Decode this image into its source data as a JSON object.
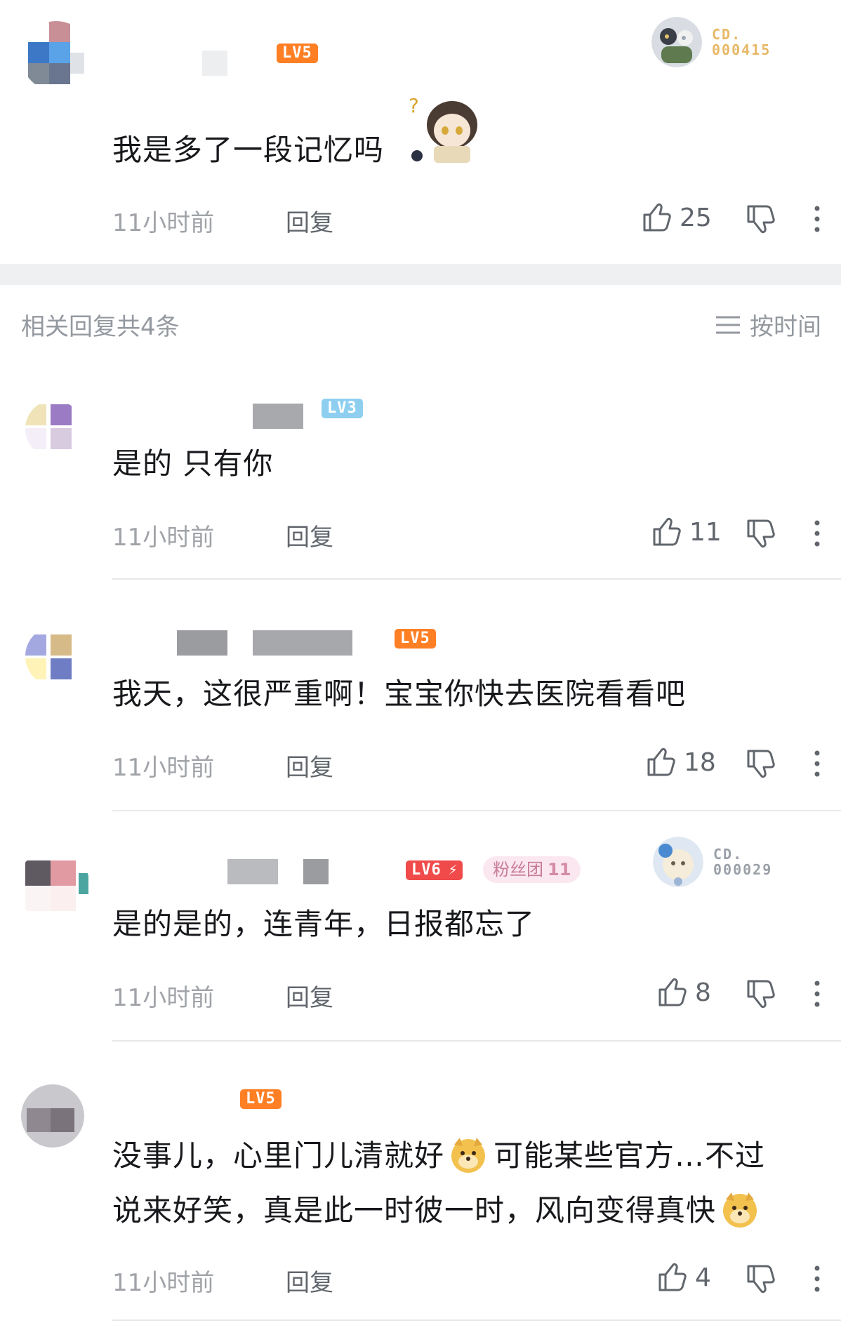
{
  "main_comment": {
    "level": "LV5",
    "text": "我是多了一段记忆吗",
    "time": "11小时前",
    "reply_label": "回复",
    "likes": "25",
    "badge": {
      "line1": "CD.",
      "line2": "000415"
    }
  },
  "related": {
    "header": "相关回复共4条",
    "sort_label": "按时间"
  },
  "replies": [
    {
      "level": "LV3",
      "text": "是的 只有你",
      "time": "11小时前",
      "reply_label": "回复",
      "likes": "11"
    },
    {
      "level": "LV5",
      "text": "我天，这很严重啊！宝宝你快去医院看看吧",
      "time": "11小时前",
      "reply_label": "回复",
      "likes": "18"
    },
    {
      "level": "LV6",
      "fan_label": "粉丝团",
      "fan_level": "11",
      "text": "是的是的，连青年，日报都忘了",
      "time": "11小时前",
      "reply_label": "回复",
      "likes": "8",
      "badge": {
        "line1": "CD.",
        "line2": "000029"
      }
    },
    {
      "level": "LV5",
      "text_line1_a": "没事儿，心里门儿清就好",
      "text_line1_b": "可能某些官方…不过",
      "text_line2": "说来好笑，真是此一时彼一时，风向变得真快",
      "time": "11小时前",
      "reply_label": "回复",
      "likes": "4"
    }
  ],
  "colors": {
    "level_orange": "#ff7f24",
    "level_blue": "#8ecff0",
    "level_red": "#f04a4a",
    "badge_gold": "#e7b866"
  }
}
